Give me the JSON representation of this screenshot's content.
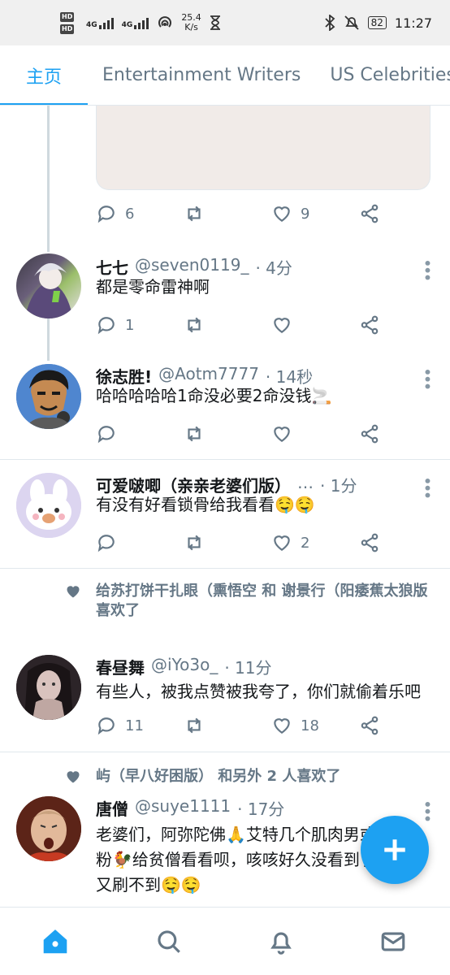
{
  "status_bar": {
    "hd1": "HD",
    "hd2": "HD",
    "net1": "4G",
    "net2": "4G",
    "speed_top": "25.4",
    "speed_bottom": "K/s",
    "battery": "82",
    "time": "11:27"
  },
  "tabs": [
    {
      "label": "主页",
      "active": true
    },
    {
      "label": "Entertainment Writers",
      "active": false
    },
    {
      "label": "US Celebrities",
      "active": false
    }
  ],
  "tweets": [
    {
      "partial": true,
      "actions": {
        "reply": "6",
        "retweet": "",
        "like": "9"
      }
    },
    {
      "name": "七七",
      "handle": "@seven0119_",
      "time": "· 4分",
      "text": "都是零命雷神啊",
      "actions": {
        "reply": "1",
        "retweet": "",
        "like": ""
      }
    },
    {
      "name": "徐志胜!",
      "handle": "@Aotm7777",
      "time": "· 14秒",
      "text": "哈哈哈哈哈1命没必要2命没钱🚬",
      "actions": {
        "reply": "",
        "retweet": "",
        "like": ""
      }
    },
    {
      "name": "可爱啵唧（亲亲老婆们版）",
      "handle": "…",
      "time": "· 1分",
      "text": "有没有好看锁骨给我看看🤤🤤",
      "actions": {
        "reply": "",
        "retweet": "",
        "like": "2"
      }
    },
    {
      "social": "给苏打饼干扎眼（熏悟空 和 谢景行（阳痿蕉太狼版 喜欢了",
      "name": "春昼舞",
      "handle": "@iYo3o_",
      "time": "· 11分",
      "text": "有些人，被我点赞被我夸了，你们就偷着乐吧",
      "actions": {
        "reply": "11",
        "retweet": "",
        "like": "18"
      }
    },
    {
      "social": "屿（早八好困版） 和另外 2 人喜欢了",
      "name": "唐僧",
      "handle": "@suye1111",
      "time": "· 17分",
      "text": "老婆们，阿弥陀佛🙏艾特几个肌肉男或者粉🐓给贫僧看看呗，咳咳好久没看到了，又刷不到🤤🤤"
    }
  ],
  "bottom_nav": [
    "home-icon",
    "search-icon",
    "bell-icon",
    "mail-icon"
  ],
  "colors": {
    "accent": "#1da1f2",
    "muted": "#657786",
    "divider": "#e1e8ed"
  }
}
